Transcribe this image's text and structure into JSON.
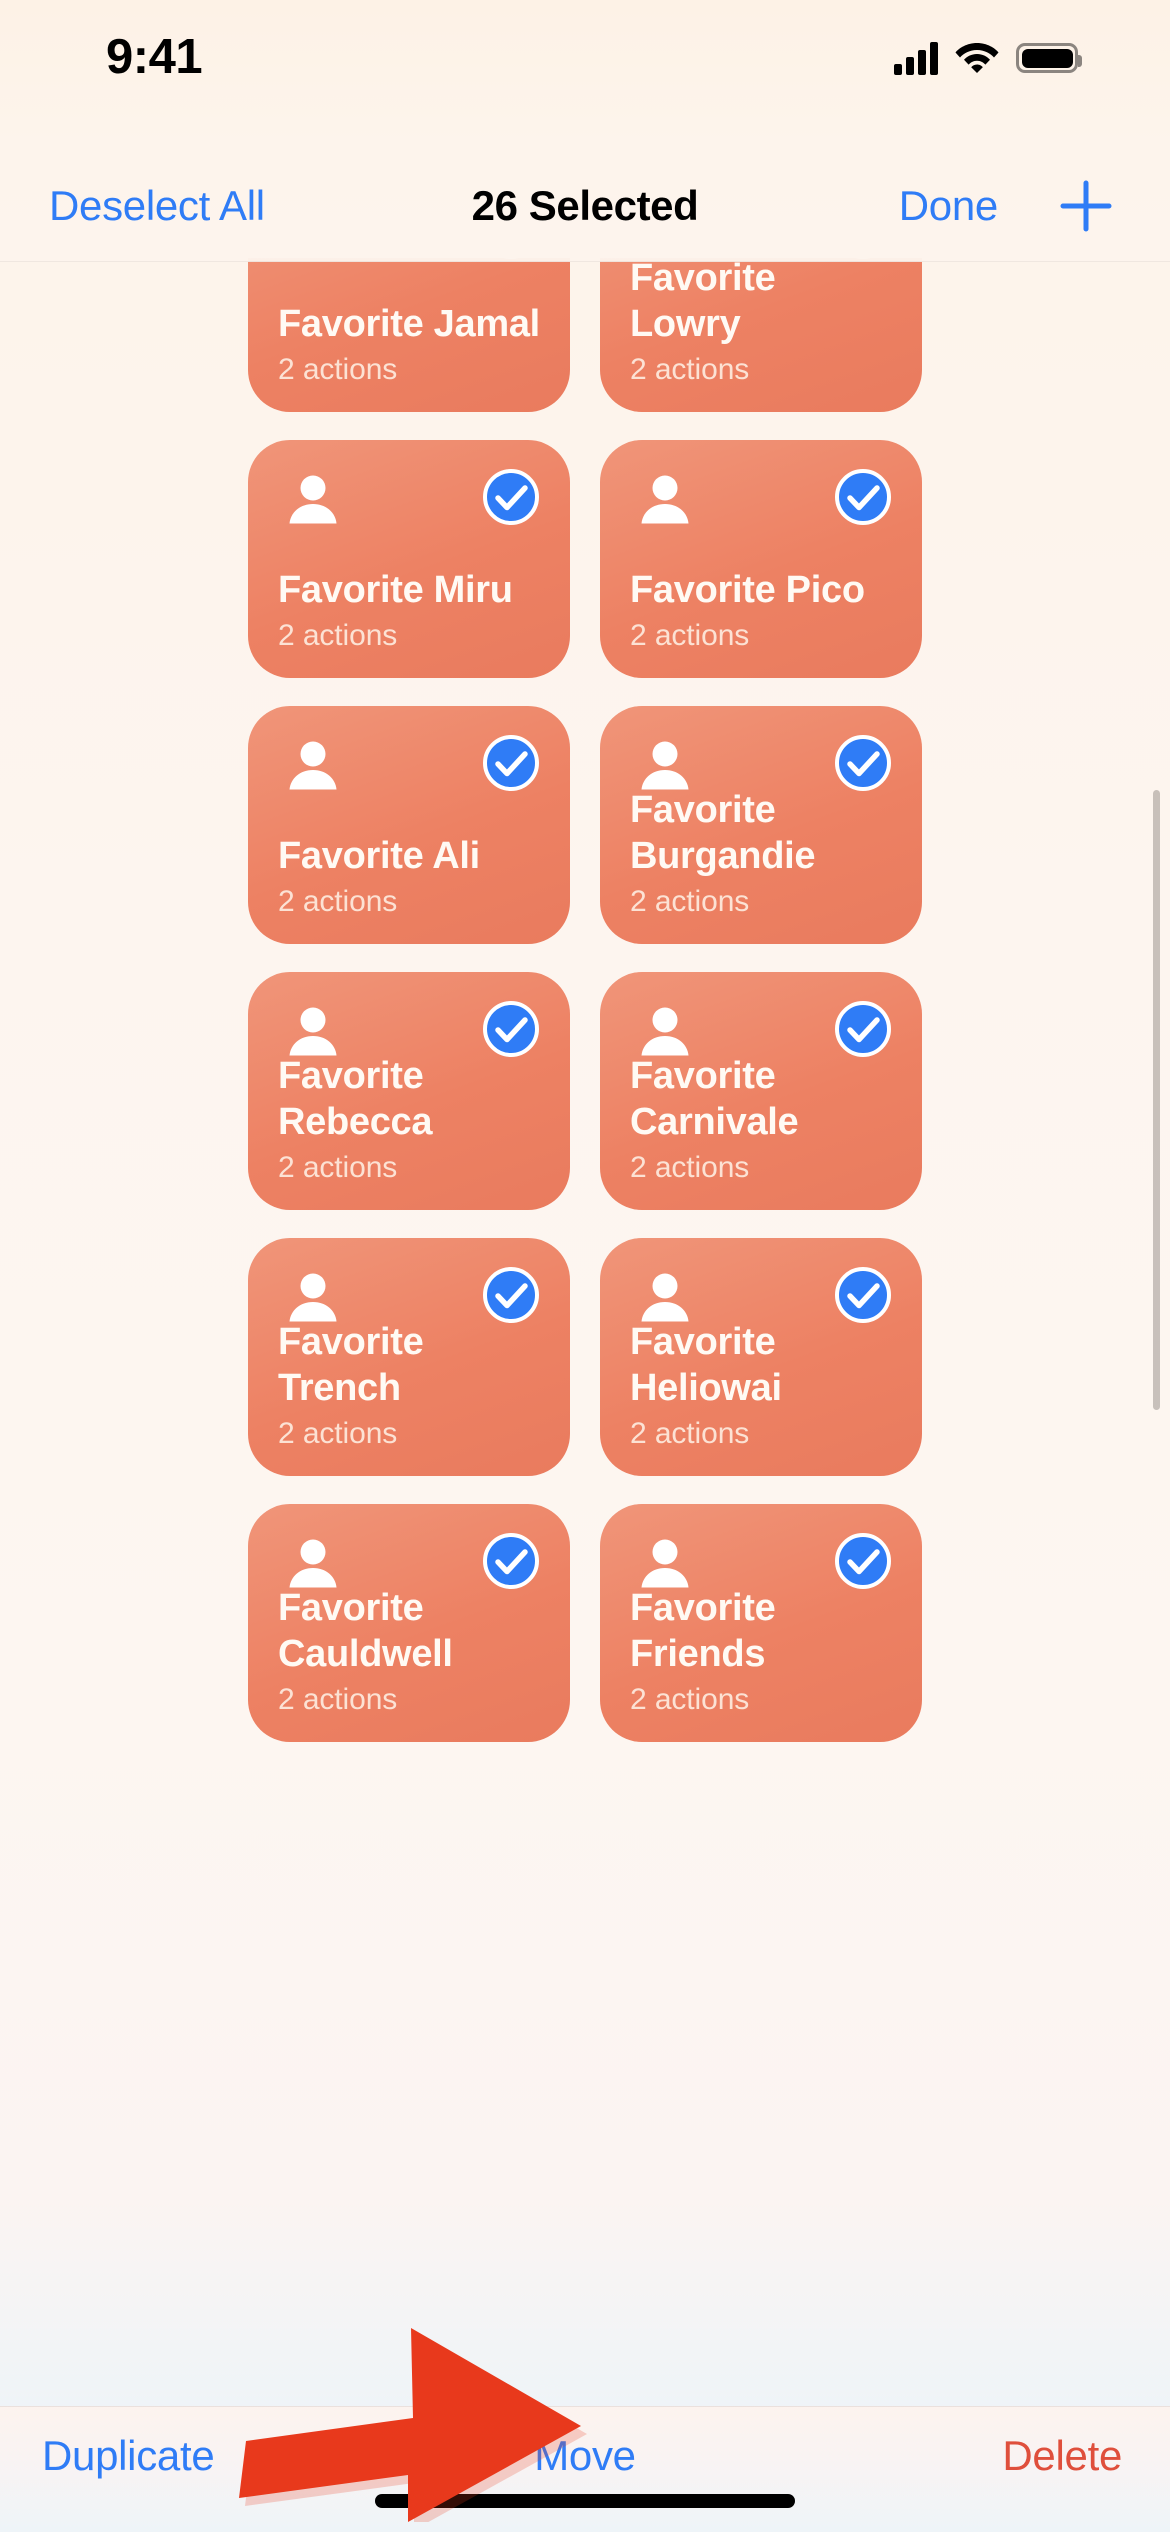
{
  "status_bar": {
    "time": "9:41",
    "cellular_icon": "cellular-signal-icon",
    "wifi_icon": "wifi-icon",
    "battery_icon": "battery-full-icon"
  },
  "nav_bar": {
    "deselect_all_label": "Deselect All",
    "title": "26 Selected",
    "done_label": "Done",
    "add_icon": "plus-icon",
    "accent_color": "#2f7cf6",
    "title_color": "#000000"
  },
  "grid": {
    "subtitle_text": "2 actions",
    "card_color_start": "#f09579",
    "card_color_end": "#e97b5e",
    "check_color": "#2f7cf6",
    "cards": [
      {
        "title": "Favorite Jamal",
        "subtitle": "2 actions",
        "selected": true
      },
      {
        "title": "Favorite Lowry",
        "subtitle": "2 actions",
        "selected": true
      },
      {
        "title": "Favorite Miru",
        "subtitle": "2 actions",
        "selected": true
      },
      {
        "title": "Favorite Pico",
        "subtitle": "2 actions",
        "selected": true
      },
      {
        "title": "Favorite Ali",
        "subtitle": "2 actions",
        "selected": true
      },
      {
        "title": "Favorite Burgandie",
        "subtitle": "2 actions",
        "selected": true
      },
      {
        "title": "Favorite Rebecca",
        "subtitle": "2 actions",
        "selected": true
      },
      {
        "title": "Favorite Carnivale",
        "subtitle": "2 actions",
        "selected": true
      },
      {
        "title": "Favorite Trench",
        "subtitle": "2 actions",
        "selected": true
      },
      {
        "title": "Favorite Heliowai",
        "subtitle": "2 actions",
        "selected": true
      },
      {
        "title": "Favorite Cauldwell",
        "subtitle": "2 actions",
        "selected": true
      },
      {
        "title": "Favorite Friends",
        "subtitle": "2 actions",
        "selected": true
      }
    ]
  },
  "toolbar": {
    "duplicate_label": "Duplicate",
    "move_label": "Move",
    "delete_label": "Delete",
    "accent_color": "#2f7cf6",
    "delete_color": "#df4f3c"
  },
  "annotation": {
    "arrow_icon": "red-arrow-pointing-right",
    "arrow_color": "#e8391c",
    "points_at": "Move"
  }
}
